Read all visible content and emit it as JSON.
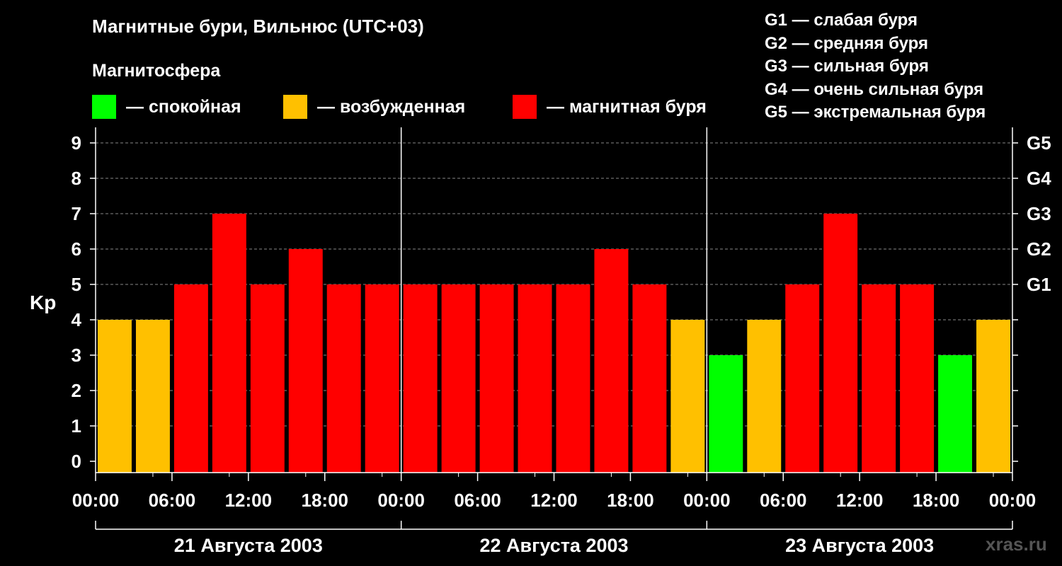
{
  "title": "Магнитные бури, Вильнюс (UTC+03)",
  "legend_title": "Магнитосфера",
  "legend": [
    {
      "label": "— спокойная",
      "color": "#00ff00"
    },
    {
      "label": "— возбужденная",
      "color": "#ffc000"
    },
    {
      "label": "— магнитная буря",
      "color": "#ff0000"
    }
  ],
  "g_legend": [
    "G1 — слабая буря",
    "G2 — средняя буря",
    "G3 — сильная буря",
    "G4 — очень сильная буря",
    "G5 — экстремальная буря"
  ],
  "watermark": "xras.ru",
  "chart_data": {
    "type": "bar",
    "ylabel": "Kp",
    "ylim": [
      0,
      9
    ],
    "y_ticks": [
      "0",
      "1",
      "2",
      "3",
      "4",
      "5",
      "6",
      "7",
      "8",
      "9"
    ],
    "right_ticks": [
      {
        "value": 5,
        "label": "G1"
      },
      {
        "value": 6,
        "label": "G2"
      },
      {
        "value": 7,
        "label": "G3"
      },
      {
        "value": 8,
        "label": "G4"
      },
      {
        "value": 9,
        "label": "G5"
      }
    ],
    "x_tick_labels": [
      "00:00",
      "06:00",
      "12:00",
      "18:00",
      "00:00",
      "06:00",
      "12:00",
      "18:00",
      "00:00",
      "06:00",
      "12:00",
      "18:00",
      "00:00"
    ],
    "days": [
      "21 Августа 2003",
      "22 Августа 2003",
      "23 Августа 2003"
    ],
    "values": [
      4,
      4,
      5,
      7,
      5,
      6,
      5,
      5,
      5,
      5,
      5,
      5,
      5,
      6,
      5,
      4,
      3,
      4,
      5,
      7,
      5,
      5,
      3,
      4
    ],
    "colors": {
      "quiet": "#00ff00",
      "active": "#ffc000",
      "storm": "#ff0000"
    },
    "grid": true
  }
}
